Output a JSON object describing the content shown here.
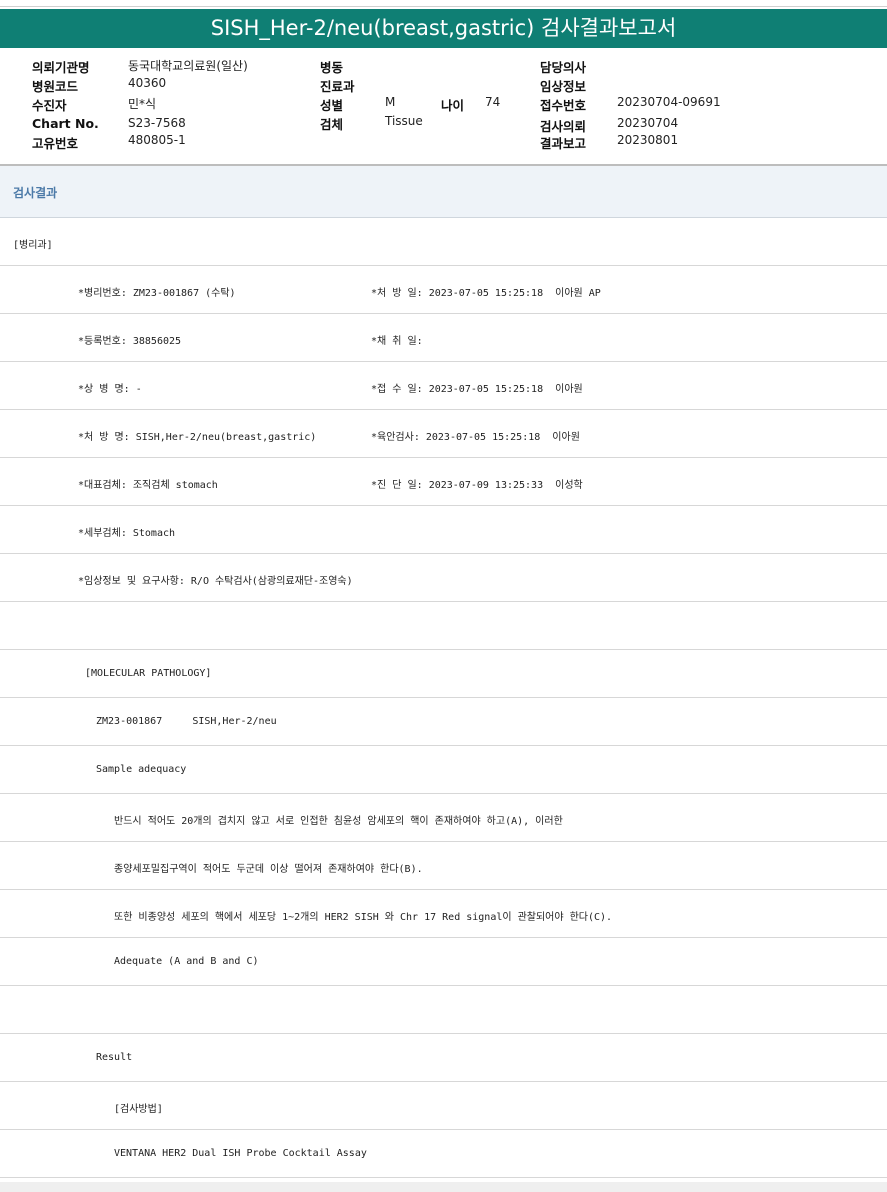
{
  "title": "SISH_Her-2/neu(breast,gastric) 검사결과보고서",
  "info": {
    "col1": [
      {
        "label": "의뢰기관명",
        "value": "동국대학교의료원(일산)"
      },
      {
        "label": "병원코드",
        "value": "40360"
      },
      {
        "label": "수진자",
        "value": "민*식"
      },
      {
        "label": "Chart No.",
        "value": "S23-7568"
      },
      {
        "label": "고유번호",
        "value": "480805-1"
      }
    ],
    "col2": [
      {
        "label": "병동",
        "value": ""
      },
      {
        "label": "진료과",
        "value": ""
      },
      {
        "label": "성별",
        "value": "M"
      },
      {
        "label": "검체",
        "value": "Tissue"
      }
    ],
    "age": {
      "label": "나이",
      "value": "74"
    },
    "col3": [
      {
        "label": "담당의사",
        "value": ""
      },
      {
        "label": "임상정보",
        "value": ""
      },
      {
        "label": "접수번호",
        "value": "20230704-09691"
      },
      {
        "label": "검사의뢰",
        "value": "20230704"
      },
      {
        "label": "결과보고",
        "value": "20230801"
      }
    ]
  },
  "section_title": "검사결과",
  "rows": [
    {
      "a": "[병리과]",
      "b": ""
    },
    {
      "a": "*병리번호: ZM23-001867 (수탁)",
      "b": "*처 방 일: 2023-07-05 15:25:18  이아원 AP"
    },
    {
      "a": "*등록번호: 38856025",
      "b": "*채 취 일:"
    },
    {
      "a": "*상 병 명: -",
      "b": "*접 수 일: 2023-07-05 15:25:18  이아원"
    },
    {
      "a": "*처 방 명: SISH,Her-2/neu(breast,gastric)",
      "b": "*육안검사: 2023-07-05 15:25:18  이아원"
    },
    {
      "a": "*대표검체: 조직검체 stomach",
      "b": "*진 단 일: 2023-07-09 13:25:33  이성학"
    },
    {
      "a": "*세부검체: Stomach",
      "b": ""
    },
    {
      "a": "*임상정보 및 요구사항: R/O 수탁검사(삼광의료재단-조영숙)",
      "b": ""
    },
    {
      "a": "",
      "b": ""
    },
    {
      "a": "[MOLECULAR PATHOLOGY]",
      "b": ""
    },
    {
      "a": "ZM23-001867     SISH,Her-2/neu",
      "b": ""
    },
    {
      "a": "Sample adequacy",
      "b": ""
    },
    {
      "a": "반드시 적어도 20개의 겹치지 않고 서로 인접한 침윤성 암세포의 핵이 존재하여야 하고(A), 이러한",
      "b": ""
    },
    {
      "a": "종양세포밀집구역이 적어도 두군데 이상 떨어져 존재하여야 한다(B).",
      "b": ""
    },
    {
      "a": "또한 비종양성 세포의 핵에서 세포당 1~2개의 HER2 SISH 와 Chr 17 Red signal이 관찰되어야 한다(C).",
      "b": ""
    },
    {
      "a": "Adequate (A and B and C)",
      "b": ""
    },
    {
      "a": "",
      "b": ""
    },
    {
      "a": "Result",
      "b": ""
    },
    {
      "a": "[검사방법]",
      "b": ""
    },
    {
      "a": "VENTANA HER2 Dual ISH Probe Cocktail Assay",
      "b": ""
    }
  ]
}
